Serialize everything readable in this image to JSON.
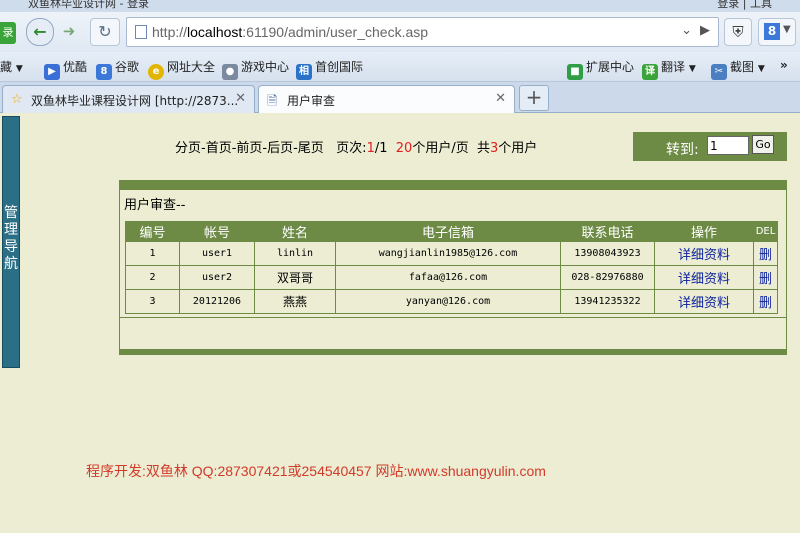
{
  "browser": {
    "window_title": "双鱼林毕业设计网 - 登录",
    "window_right": "登录 | 工具",
    "login_badge": "录",
    "address": {
      "prefix": "http://",
      "host": "localhost",
      "rest": ":61190/admin/user_check.asp"
    },
    "search_badge": "8",
    "bookmarks": [
      {
        "label": "藏",
        "icon": "favorites-icon",
        "color": "#f4b400"
      },
      {
        "label": "优酷",
        "icon": "youku-icon",
        "color": "#3a6fd8"
      },
      {
        "label": "谷歌",
        "icon": "google-icon",
        "color": "#3b78d8"
      },
      {
        "label": "网址大全",
        "icon": "url-directory-icon",
        "color": "#e2b600"
      },
      {
        "label": "游戏中心",
        "icon": "gamepad-icon",
        "color": "#7c8aa0"
      },
      {
        "label": "首创国际",
        "icon": "site-icon",
        "color": "#2a73c9"
      }
    ],
    "bookmarks_right": [
      {
        "label": "扩展中心",
        "icon": "extension-icon",
        "color": "#2f9e44"
      },
      {
        "label": "翻译",
        "icon": "translate-icon",
        "color": "#3aa43a"
      },
      {
        "label": "截图",
        "icon": "screenshot-icon",
        "color": "#4a7fc1"
      }
    ],
    "tabs": [
      {
        "label": "双鱼林毕业课程设计网 [http://2873...",
        "active": false
      },
      {
        "label": "用户审查",
        "active": true
      }
    ]
  },
  "page": {
    "sidenav_label": "管理导航",
    "pager": {
      "nav": "分页-首页-前页-后页-尾页",
      "page_prefix": "页次:",
      "page_current": "1",
      "page_total": "/1",
      "per_page": "20",
      "per_page_suffix": "个用户/页",
      "total_prefix": "共",
      "total_count": "3",
      "total_suffix": "个用户"
    },
    "goto": {
      "label": "转到:",
      "value": "1",
      "button": "Go"
    },
    "panel_title": "用户审查--",
    "table": {
      "headers": [
        "编号",
        "帐号",
        "姓名",
        "电子信箱",
        "联系电话",
        "操作",
        "DEL"
      ],
      "rows": [
        {
          "id": "1",
          "account": "user1",
          "name": "linlin",
          "email": "wangjianlin1985@126.com",
          "phone": "13908043923",
          "action": "详细资料",
          "del": "删"
        },
        {
          "id": "2",
          "account": "user2",
          "name": "双哥哥",
          "email": "fafaa@126.com",
          "phone": "028-82976880",
          "action": "详细资料",
          "del": "删"
        },
        {
          "id": "3",
          "account": "20121206",
          "name": "燕燕",
          "email": "yanyan@126.com",
          "phone": "13941235322",
          "action": "详细资料",
          "del": "删"
        }
      ]
    },
    "footer": "程序开发:双鱼林 QQ:287307421或254540457 网站:www.shuangyulin.com"
  },
  "colors": {
    "accent_green": "#6d8b45",
    "page_bg": "#ecedd3",
    "sidenav": "#2b6f86",
    "footer_red": "#d23a2a",
    "link_blue": "#0a1fa0"
  }
}
